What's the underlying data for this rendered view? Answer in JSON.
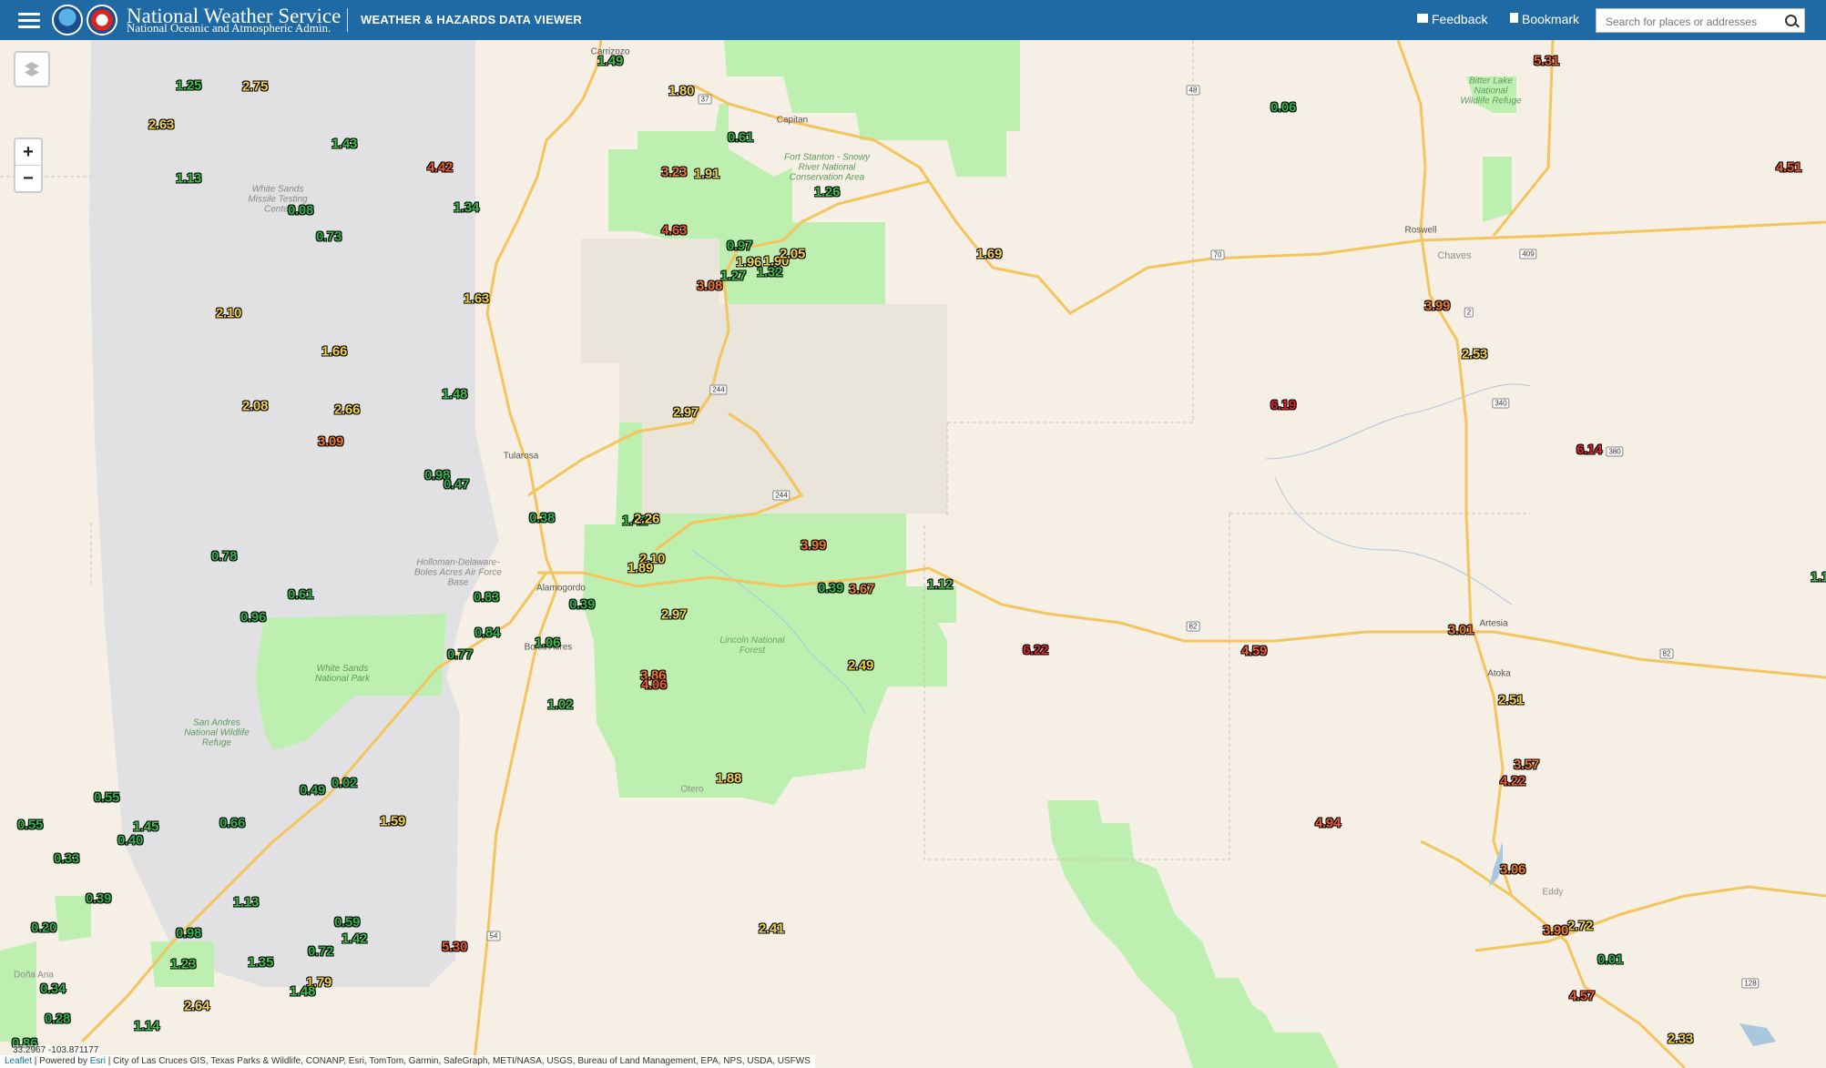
{
  "header": {
    "title": "National Weather Service",
    "subtitle": "National Oceanic and Atmospheric Admin.",
    "viewer": "WEATHER & HAZARDS DATA VIEWER",
    "feedback": "Feedback",
    "bookmark": "Bookmark",
    "search_placeholder": "Search for places or addresses"
  },
  "map": {
    "zoom_in": "+",
    "zoom_out": "−",
    "coordinates": "33.2967  -103.871177",
    "attribution_leaflet": "Leaflet",
    "attribution_esri": "Esri",
    "attribution_sources": "| City of Las Cruces GIS, Texas Parks & Wildlife, CONANP, Esri, TomTom, Garmin, SafeGraph, METI/NASA, USGS, Bureau of Land Management, EPA, NPS, USDA, USFWS",
    "attribution_powered": " | Powered by ",
    "place_labels": [
      "Carrizozo",
      "Capitan",
      "Tularosa",
      "Alamogordo",
      "Boles Acres",
      "Roswell",
      "Chaves",
      "Artesia",
      "Atoka",
      "Eddy",
      "Otero",
      "Doña Ana"
    ],
    "area_labels": [
      "White Sands Missile Testing Center",
      "Fort Stanton - Snowy River National Conservation Area",
      "Holloman-Delaware-Boles Acres Air Force Base",
      "White Sands National Park",
      "San Andres National Wildlife Refuge",
      "Lincoln National Forest",
      "Bitter Lake National Wildlife Refuge"
    ],
    "highways": [
      "37",
      "48",
      "70",
      "409",
      "2",
      "340",
      "380",
      "244",
      "82",
      "54",
      "285",
      "128"
    ],
    "precip_values": [
      "1.25",
      "2.75",
      "2.63",
      "1.43",
      "1.13",
      "4.42",
      "0.08",
      "1.34",
      "0.73",
      "2.10",
      "1.63",
      "1.66",
      "2.08",
      "2.66",
      "1.48",
      "3.09",
      "0.98",
      "0.47",
      "0.38",
      "0.78",
      "0.61",
      "0.96",
      "0.83",
      "0.84",
      "0.77",
      "1.06",
      "1.02",
      "0.55",
      "0.49",
      "0.02",
      "0.55",
      "1.45",
      "0.66",
      "0.40",
      "1.59",
      "0.33",
      "0.39",
      "1.13",
      "0.20",
      "0.59",
      "1.42",
      "0.98",
      "1.23",
      "0.72",
      "1.35",
      "1.79",
      "1.48",
      "2.64",
      "0.34",
      "0.28",
      "1.14",
      "0.86",
      "1.49",
      "1.80",
      "0.61",
      "3.23",
      "1.91",
      "1.26",
      "4.63",
      "0.97",
      "1.96",
      "1.90",
      "2.05",
      "1.27",
      "1.32",
      "3.08",
      "1.69",
      "2.97",
      "1.42",
      "2.26",
      "3.99",
      "2.10",
      "1.89",
      "0.39",
      "3.67",
      "1.12",
      "0.39",
      "2.97",
      "3.86",
      "4.06",
      "2.49",
      "1.88",
      "2.41",
      "5.30",
      "0.06",
      "5.31",
      "4.51",
      "3.99",
      "2.53",
      "6.19",
      "6.14",
      "6.22",
      "4.59",
      "3.01",
      "2.51",
      "3.57",
      "4.22",
      "4.94",
      "3.06",
      "2.72",
      "3.90",
      "0.01",
      "4.57",
      "2.33",
      "1.1"
    ]
  }
}
